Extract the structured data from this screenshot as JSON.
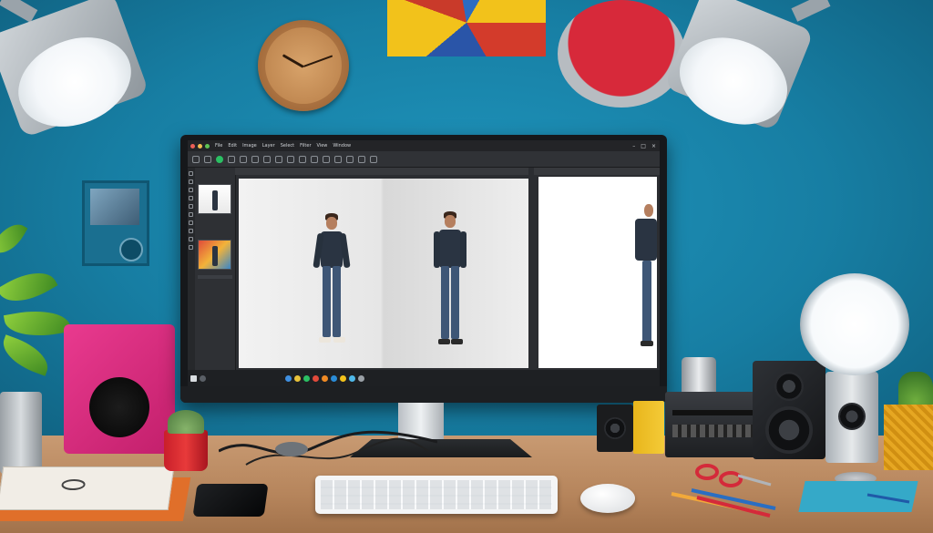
{
  "app": {
    "menu": [
      "File",
      "Edit",
      "Image",
      "Layer",
      "Select",
      "Filter",
      "View",
      "Window"
    ],
    "canvas_tab_label": "",
    "preview_tab_label": "",
    "statusbar_text": ""
  },
  "colors": {
    "wall": "#1a86ad",
    "desk": "#b6855c",
    "monitor_bezel": "#16181b",
    "app_panel": "#2b2d31",
    "canvas_bg": "#ececec",
    "speaker_pink": "#e93a8f",
    "lamp_light": "#ffffff"
  },
  "icons": {
    "traffic_lights": [
      "close-dot",
      "minimize-dot",
      "maximize-dot"
    ],
    "taskbar": [
      "start-icon",
      "search-icon",
      "folder-icon",
      "browser-icon",
      "mail-icon",
      "photo-icon",
      "settings-icon",
      "store-icon"
    ]
  }
}
